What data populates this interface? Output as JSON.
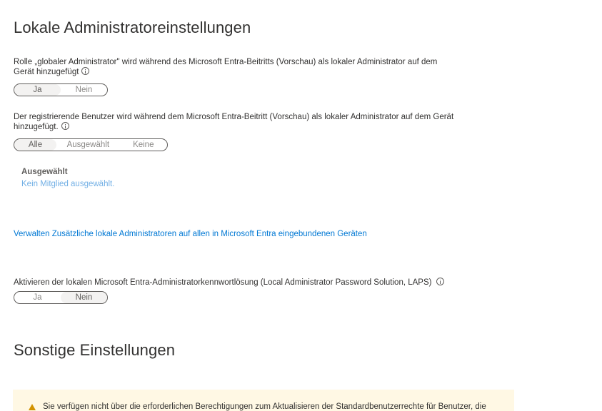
{
  "section_local_admin": {
    "title": "Lokale Administratoreinstellungen",
    "global_admin": {
      "label_line1": "Rolle „globaler Administrator\" wird während des Microsoft Entra-Beitritts (Vorschau) als lokaler Administrator auf dem",
      "label_line2": "Gerät hinzugefügt",
      "options": [
        "Ja",
        "Nein"
      ],
      "selected": "Ja"
    },
    "registering_user": {
      "label_line1": "Der registrierende Benutzer wird während dem Microsoft Entra-Beitritt (Vorschau) als lokaler Administrator auf dem Gerät",
      "label_line2": "hinzugefügt.",
      "options": [
        "Alle",
        "Ausgewählt",
        "Keine"
      ],
      "selected": "Alle"
    },
    "selected_block": {
      "heading": "Ausgewählt",
      "value": "Kein Mitglied ausgewählt."
    },
    "manage_link": "Verwalten Zusätzliche lokale Administratoren auf allen in Microsoft Entra eingebundenen Geräten",
    "laps": {
      "label": "Aktivieren der lokalen Microsoft Entra-Administratorkennwortlösung (Local Administrator Password Solution, LAPS)",
      "options": [
        "Ja",
        "Nein"
      ],
      "selected": "Nein"
    }
  },
  "section_other": {
    "title": "Sonstige Einstellungen",
    "warning_text": "Sie verfügen nicht über die erforderlichen Berechtigungen zum Aktualisieren der Standardbenutzerrechte für Benutzer, die"
  },
  "icons": {
    "info": "info-icon",
    "warning": "warning-icon"
  }
}
